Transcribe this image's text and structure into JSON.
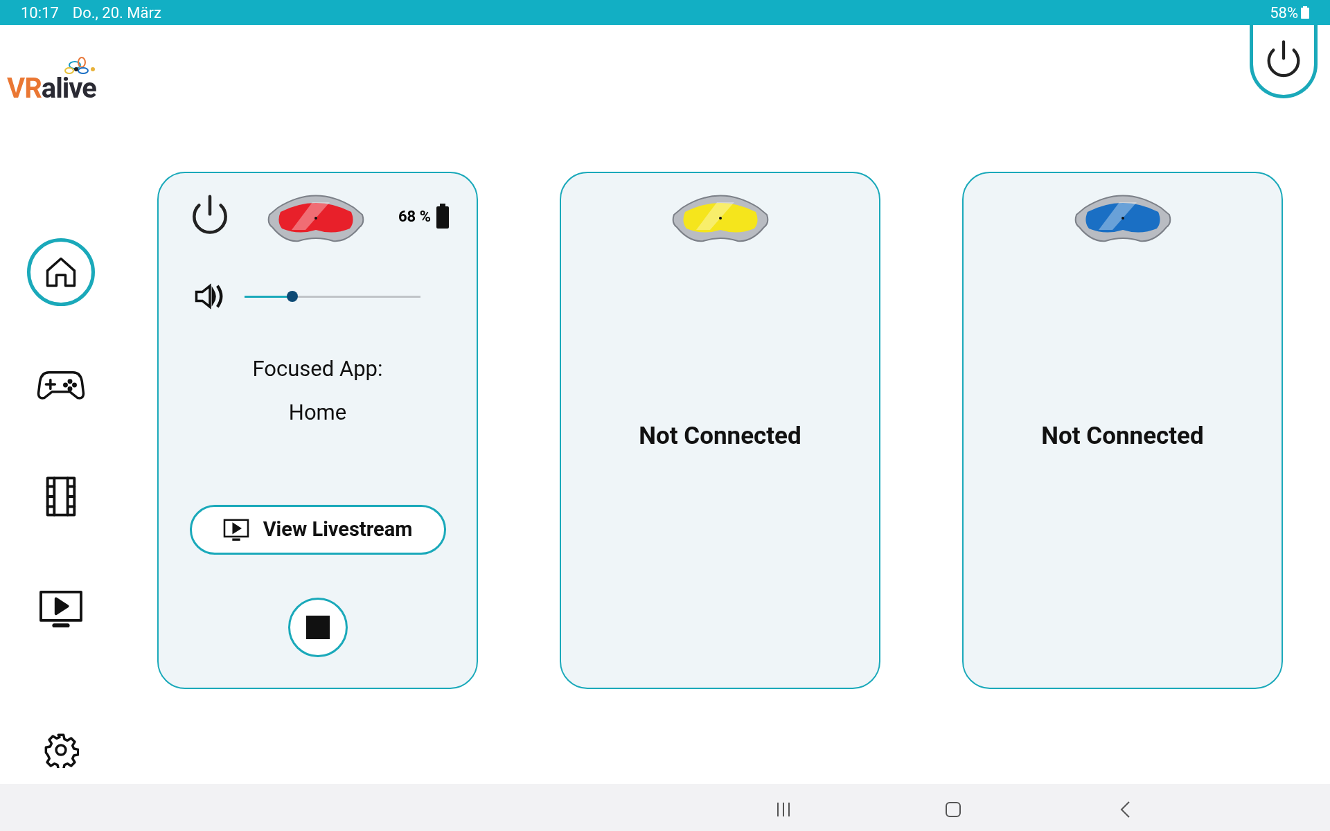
{
  "status_bar": {
    "time": "10:17",
    "date": "Do., 20. März",
    "battery": "58%"
  },
  "logo": {
    "part_1": "VR",
    "part_2": "alive"
  },
  "sidebar": {
    "items": [
      {
        "kind": "home",
        "selected": true
      },
      {
        "kind": "gamepad",
        "selected": false
      },
      {
        "kind": "film",
        "selected": false
      },
      {
        "kind": "screen",
        "selected": false
      },
      {
        "kind": "settings",
        "selected": false
      }
    ]
  },
  "headsets": [
    {
      "kind": "connected",
      "color": "#e8202a",
      "battery": "68 %",
      "volume": {
        "level": 0.27
      },
      "focused_label": "Focused App:",
      "focused_app": "Home",
      "livestream_button": "View Livestream"
    },
    {
      "kind": "disconnected",
      "color": "#f5e51c",
      "status": "Not Connected"
    },
    {
      "kind": "disconnected",
      "color": "#1a6fc4",
      "status": "Not Connected"
    }
  ]
}
